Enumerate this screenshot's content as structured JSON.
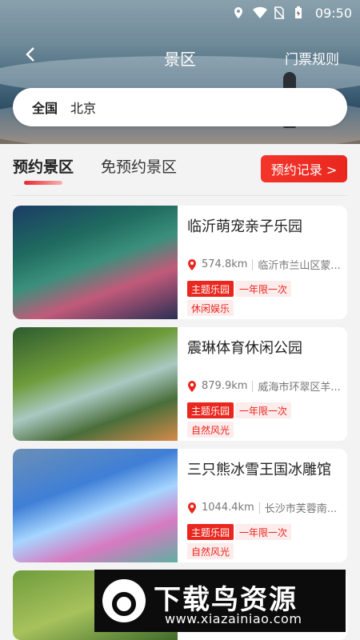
{
  "status_bar": {
    "time": "09:50",
    "icons": [
      "location-icon",
      "wifi-icon",
      "no-sim-icon",
      "battery-icon"
    ]
  },
  "header": {
    "title": "景区",
    "rules_link": "门票规则",
    "back_icon": "back-arrow-icon"
  },
  "search": {
    "region": "全国",
    "city": "北京"
  },
  "tabs": [
    {
      "label": "预约景区",
      "active": true
    },
    {
      "label": "免预约景区",
      "active": false
    }
  ],
  "record_button": "预约记录 >",
  "cards": [
    {
      "name": "临沂萌宠亲子乐园",
      "distance": "574.8km",
      "address": "临沂市兰山区蒙...",
      "tags": [
        "主题乐园",
        "一年限一次",
        "休闲娱乐"
      ]
    },
    {
      "name": "震琳体育休闲公园",
      "distance": "879.9km",
      "address": "威海市环翠区羊...",
      "tags": [
        "主题乐园",
        "一年限一次",
        "自然风光"
      ]
    },
    {
      "name": "三只熊冰雪王国冰雕馆",
      "distance": "1044.4km",
      "address": "长沙市芙蓉南...",
      "tags": [
        "主题乐园",
        "一年限一次",
        "自然风光"
      ]
    }
  ],
  "watermark": {
    "title": "下载鸟资源",
    "url": "www.xiazainiao.com"
  },
  "colors": {
    "accent": "#e9271f",
    "tag_bg": "#fdecec"
  }
}
